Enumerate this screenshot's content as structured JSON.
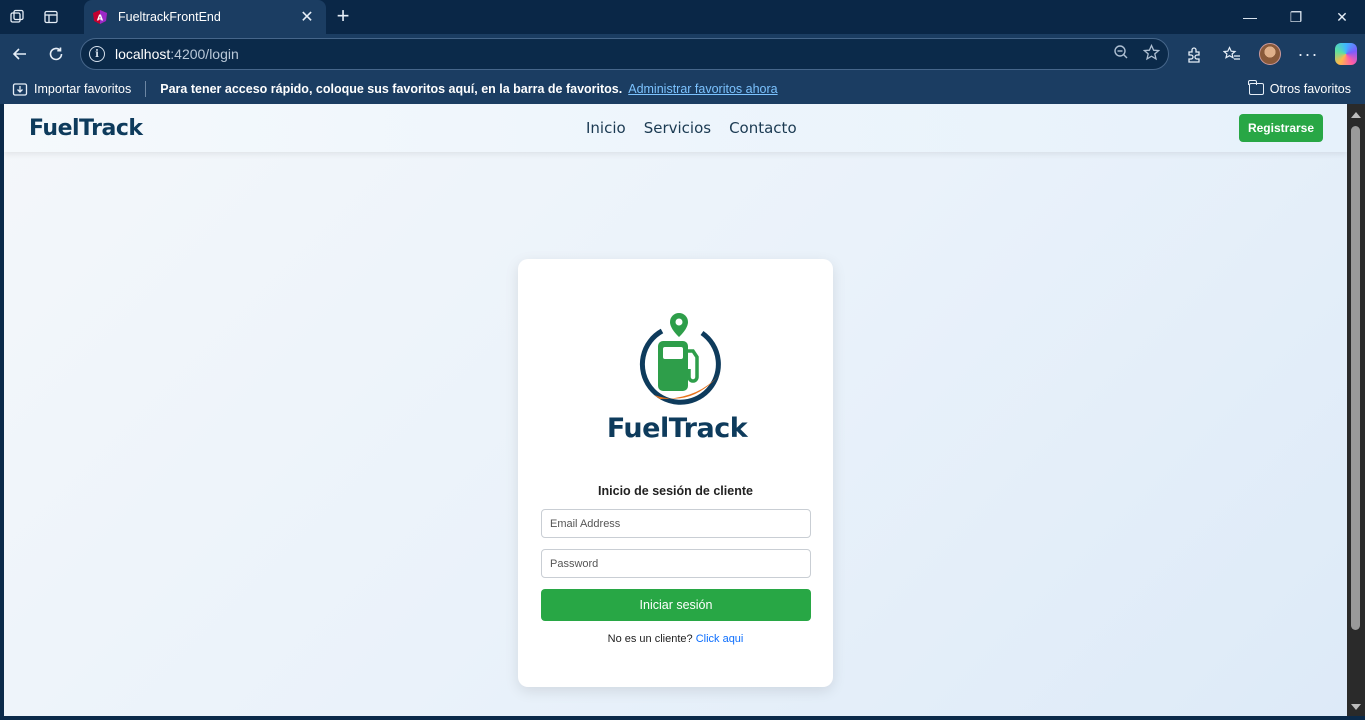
{
  "browser": {
    "tab_title": "FueltrackFrontEnd",
    "url_host": "localhost",
    "url_rest": ":4200/login",
    "favorites": {
      "import_label": "Importar favoritos",
      "message": "Para tener acceso rápido, coloque sus favoritos aquí, en la barra de favoritos.",
      "manage_link": "Administrar favoritos ahora",
      "other_label": "Otros favoritos"
    }
  },
  "navbar": {
    "brand": "FuelTrack",
    "links": [
      "Inicio",
      "Servicios",
      "Contacto"
    ],
    "register_label": "Registrarse"
  },
  "login": {
    "logo_text": "FuelTrack",
    "title": "Inicio de sesión de cliente",
    "email_placeholder": "Email Address",
    "password_placeholder": "Password",
    "submit_label": "Iniciar sesión",
    "signup_prompt": "No es un cliente?",
    "signup_link": "Click aqui"
  },
  "colors": {
    "brand_navy": "#0e3b5c",
    "accent_green": "#28a745",
    "logo_green": "#2e9e4a",
    "logo_orange": "#e8731c",
    "link_blue": "#0d6efd"
  }
}
